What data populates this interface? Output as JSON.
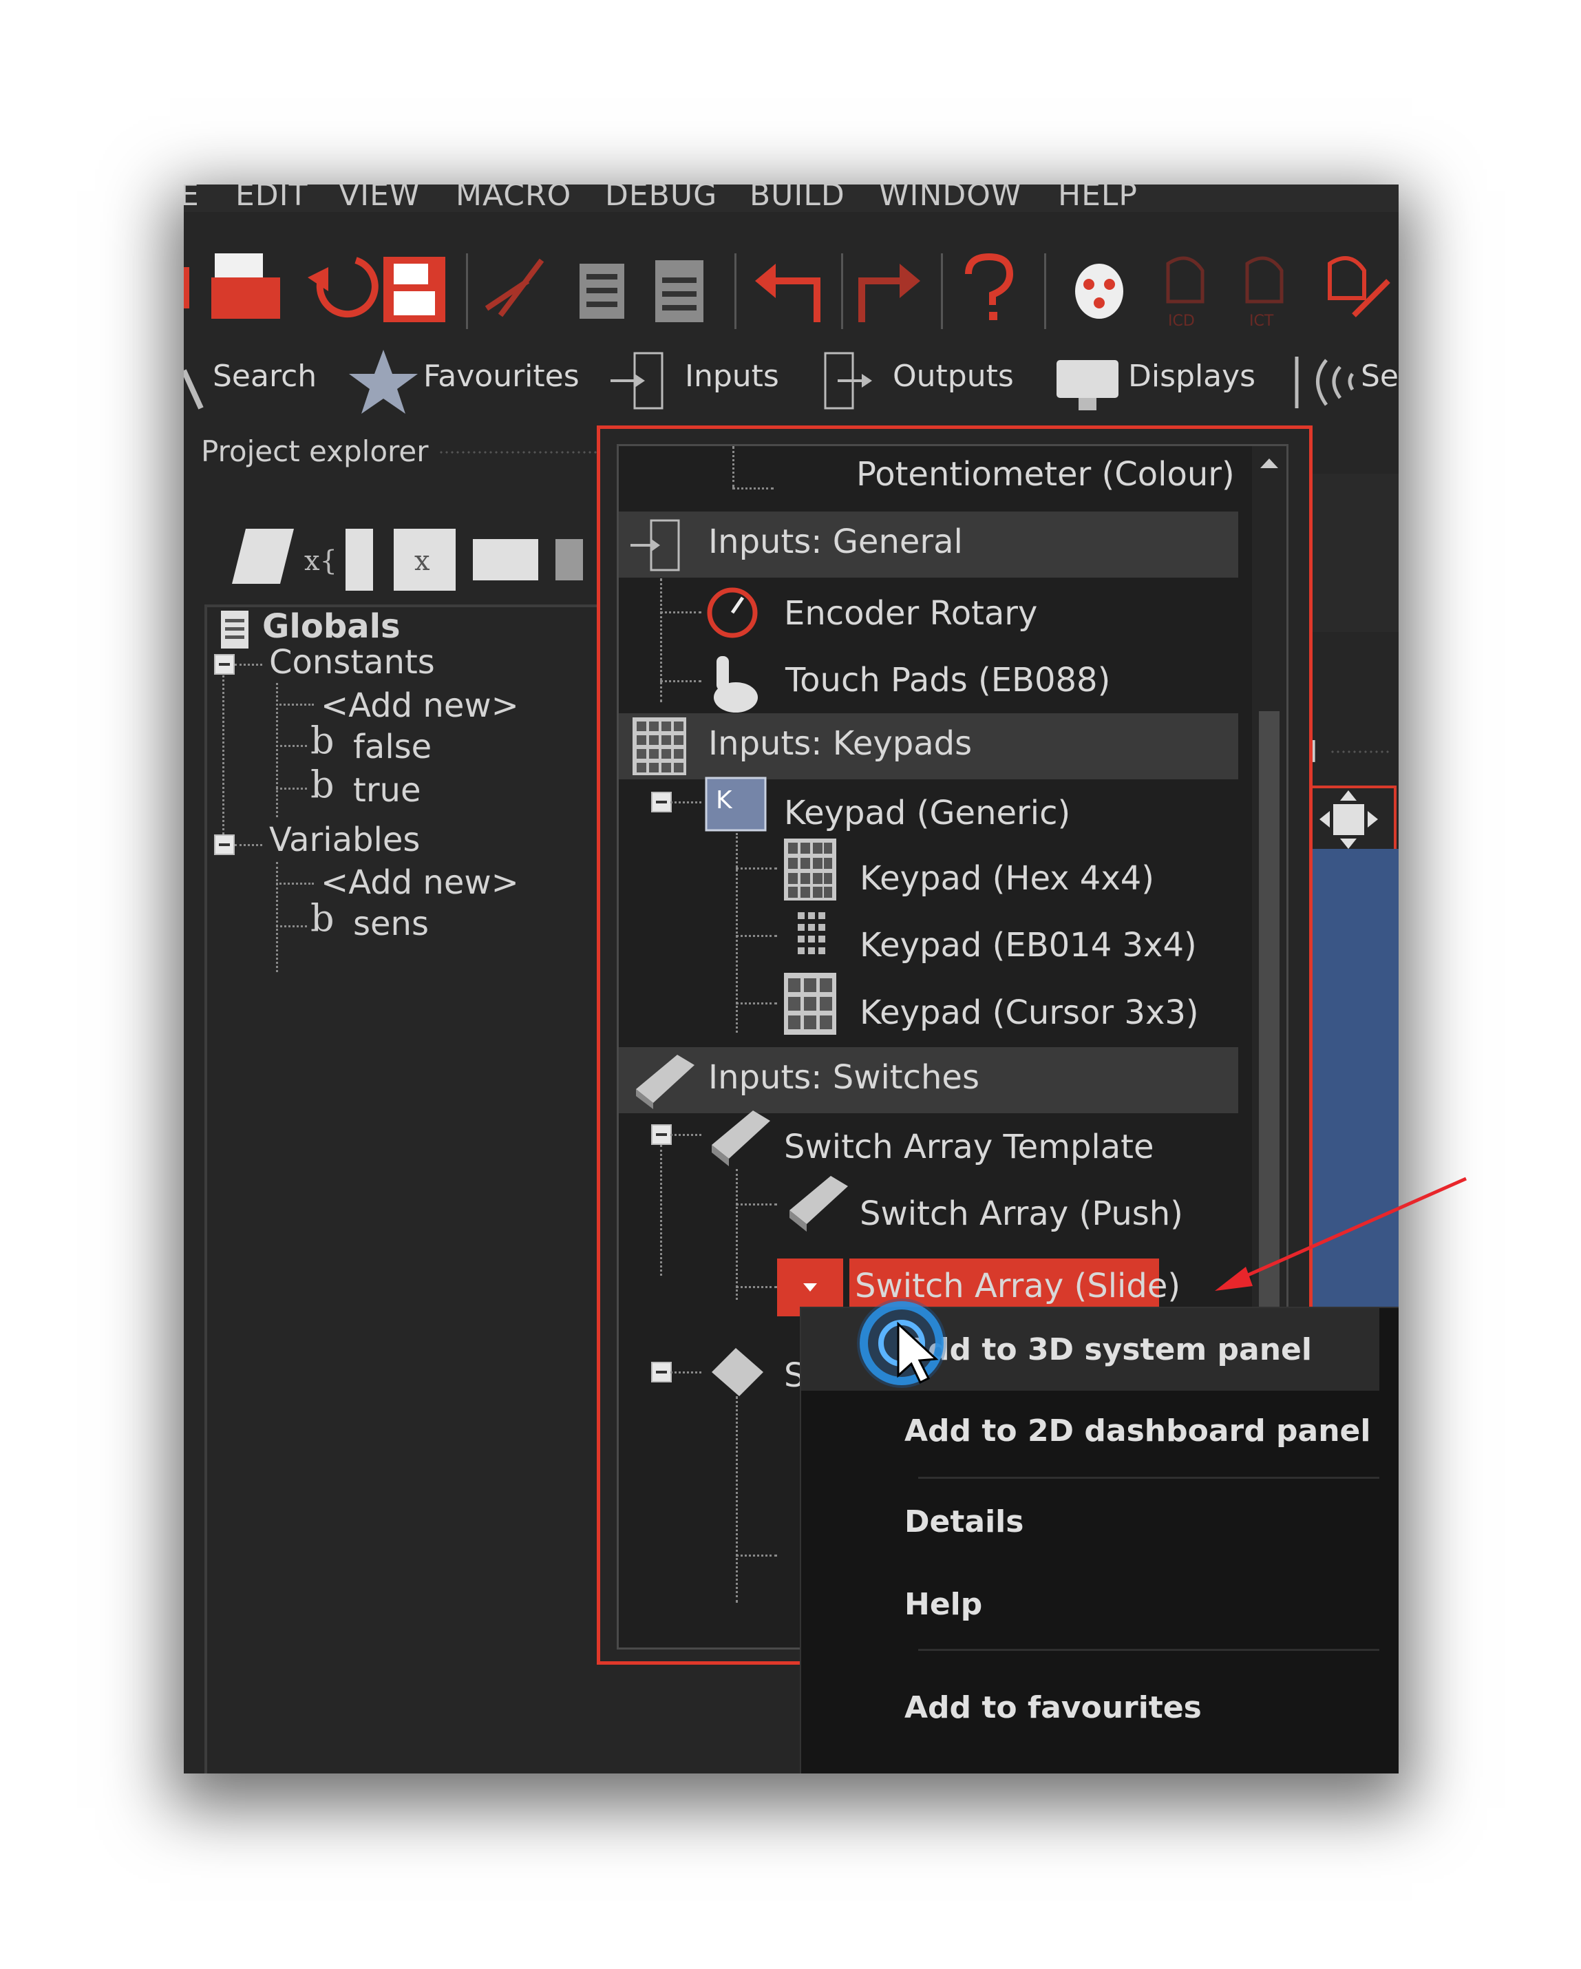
{
  "menu": {
    "items": [
      "E",
      "EDIT",
      "VIEW",
      "MACRO",
      "DEBUG",
      "BUILD",
      "WINDOW",
      "HELP"
    ]
  },
  "toolbar": {
    "icons": [
      "print-icon",
      "refresh-icon",
      "save-icon",
      "cut-icon",
      "copy-icon",
      "paste-icon",
      "undo-icon",
      "redo-icon",
      "help-icon",
      "bug-icon",
      "icd-icon",
      "ict-icon",
      "chip-config-icon"
    ],
    "icd_label": "ICD",
    "ict_label": "ICT"
  },
  "component_tabs": {
    "search": "Search",
    "favourites": "Favourites",
    "inputs": "Inputs",
    "outputs": "Outputs",
    "displays": "Displays",
    "comms_partial": "Se"
  },
  "project_explorer": {
    "title": "Project explorer",
    "tree": {
      "globals": "Globals",
      "constants": "Constants",
      "constants_add": "<Add new>",
      "const_false": "false",
      "const_true": "true",
      "variables": "Variables",
      "variables_add": "<Add new>",
      "var_sens": "sens",
      "bool_glyph": "b"
    }
  },
  "component_list": {
    "top_item": "Potentiometer (Colour)",
    "cat_general": "Inputs: General",
    "encoder": "Encoder Rotary",
    "touch": "Touch Pads (EB088)",
    "cat_keypads": "Inputs: Keypads",
    "keypad_generic": "Keypad (Generic)",
    "keypad_hex": "Keypad (Hex 4x4)",
    "keypad_eb014": "Keypad (EB014 3x4)",
    "keypad_cursor": "Keypad (Cursor 3x3)",
    "cat_switches": "Inputs: Switches",
    "switch_template": "Switch Array Template",
    "switch_push": "Switch Array (Push)",
    "switch_slide": "Switch Array (Slide)",
    "partial_next": "S",
    "keypad_glyph": "K"
  },
  "context_menu": {
    "add_3d": "Add to 3D system panel",
    "add_2d": "Add to 2D dashboard panel",
    "details": "Details",
    "help": "Help",
    "favourites": "Add to favourites"
  },
  "right_panel": {
    "partial_label": "el"
  },
  "colors": {
    "accent": "#d83a2b",
    "background": "#262626",
    "workspace_blue": "#3a5686"
  }
}
